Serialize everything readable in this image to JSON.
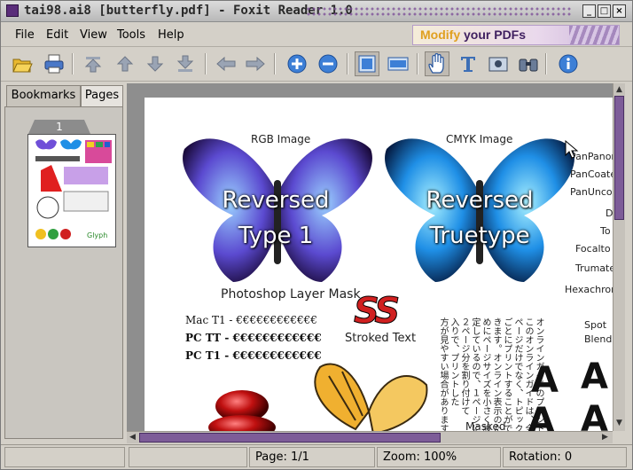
{
  "window": {
    "title": "tai98.ai8 [butterfly.pdf] - Foxit Reader 1.0"
  },
  "window_buttons": {
    "minimize": "_",
    "maximize": "□",
    "close": "×"
  },
  "menu": {
    "items": [
      {
        "label": "File"
      },
      {
        "label": "Edit"
      },
      {
        "label": "View"
      },
      {
        "label": "Tools"
      },
      {
        "label": "Help"
      }
    ]
  },
  "banner": {
    "text_highlight": "Modify",
    "text_rest": " your PDFs"
  },
  "toolbar": {
    "icons": [
      "open-icon",
      "print-icon",
      "first-page-icon",
      "previous-page-icon",
      "next-page-icon",
      "last-page-icon",
      "back-icon",
      "forward-icon",
      "zoom-in-icon",
      "zoom-out-icon",
      "fit-page-icon",
      "fit-width-icon",
      "hand-tool-icon",
      "text-select-icon",
      "snapshot-icon",
      "find-icon",
      "about-icon"
    ]
  },
  "sidebar": {
    "tabs": [
      {
        "label": "Bookmarks"
      },
      {
        "label": "Pages"
      }
    ],
    "active_tab": "Pages",
    "thumbnail_number": "1"
  },
  "document": {
    "rgb_label": "RGB Image",
    "cmyk_label": "CMYK Image",
    "left_butterfly_text_1": "Reversed",
    "left_butterfly_text_2": "Type 1",
    "right_butterfly_text_1": "Reversed",
    "right_butterfly_text_2": "Truetype",
    "mask_label": "Photoshop Layer Mask",
    "mac_line": "Mac T1 - €€€€€€€€€€€€",
    "pc_tt_line": "PC TT - €€€€€€€€€€€€",
    "pc_t1_line": "PC T1 - €€€€€€€€€€€€",
    "stroked_glyphs": "SS",
    "stroked_label": "Stroked Text",
    "masked_label": "Masked",
    "glyph_big": "A",
    "japanese_columns": [
      "オンラインガイドのプリント",
      "このオンラインガイドは、全",
      "ページだけでなく、トピック",
      "ごとにプリントすることがで",
      "きます。オンライン表示のた",
      "めにページサイズを小さく設",
      "定しているので、１ページに",
      "２ページ分を割り付けて",
      "入りで、プリントした",
      "方が見やすい場合があります。"
    ],
    "right_list": [
      "PanPanon",
      "PanCoate",
      "PanUncoa",
      "D",
      "To",
      "Focalto",
      "Trumate",
      "Hexachron",
      "Spot",
      "Blend"
    ]
  },
  "status": {
    "cell1": "",
    "cell2": "",
    "page": "Page: 1/1",
    "zoom": "Zoom: 100%",
    "rotation": "Rotation: 0"
  },
  "colors": {
    "accent": "#7d5c98",
    "butterfly_rgb": "#6f4fd8",
    "butterfly_cmyk": "#1f8fe6",
    "stroke_red": "#d02020"
  }
}
